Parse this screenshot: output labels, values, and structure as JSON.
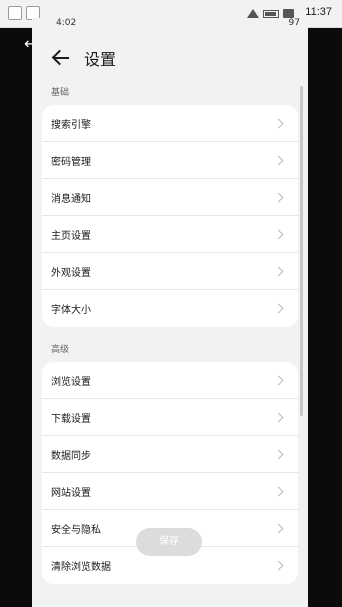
{
  "status": {
    "time": "4:02",
    "battery": "97",
    "clock": "11:37"
  },
  "header": {
    "title": "设置"
  },
  "sections": {
    "basic": {
      "label": "基础",
      "items": [
        "搜索引擎",
        "密码管理",
        "消息通知",
        "主页设置",
        "外观设置",
        "字体大小"
      ]
    },
    "advanced": {
      "label": "高级",
      "items": [
        "浏览设置",
        "下载设置",
        "数据同步",
        "网站设置",
        "安全与隐私",
        "清除浏览数据"
      ]
    }
  },
  "toast": {
    "label": "保存"
  }
}
